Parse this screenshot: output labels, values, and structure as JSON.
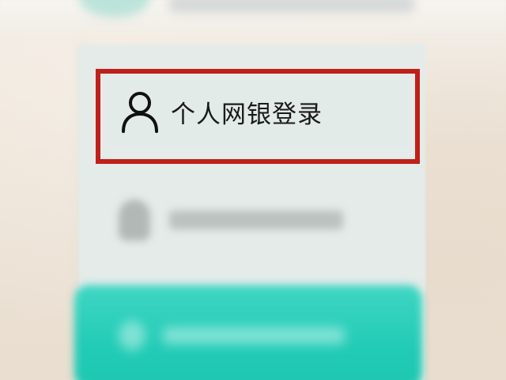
{
  "login": {
    "personal_option": {
      "label": "个人网银登录",
      "icon": "user-icon"
    },
    "secondary_option": {
      "icon": "user-icon"
    }
  },
  "colors": {
    "highlight_border": "#c0201a",
    "panel_background": "#e4ebe8",
    "action_button": "#22cbb6",
    "page_background": "#ede3d6"
  }
}
